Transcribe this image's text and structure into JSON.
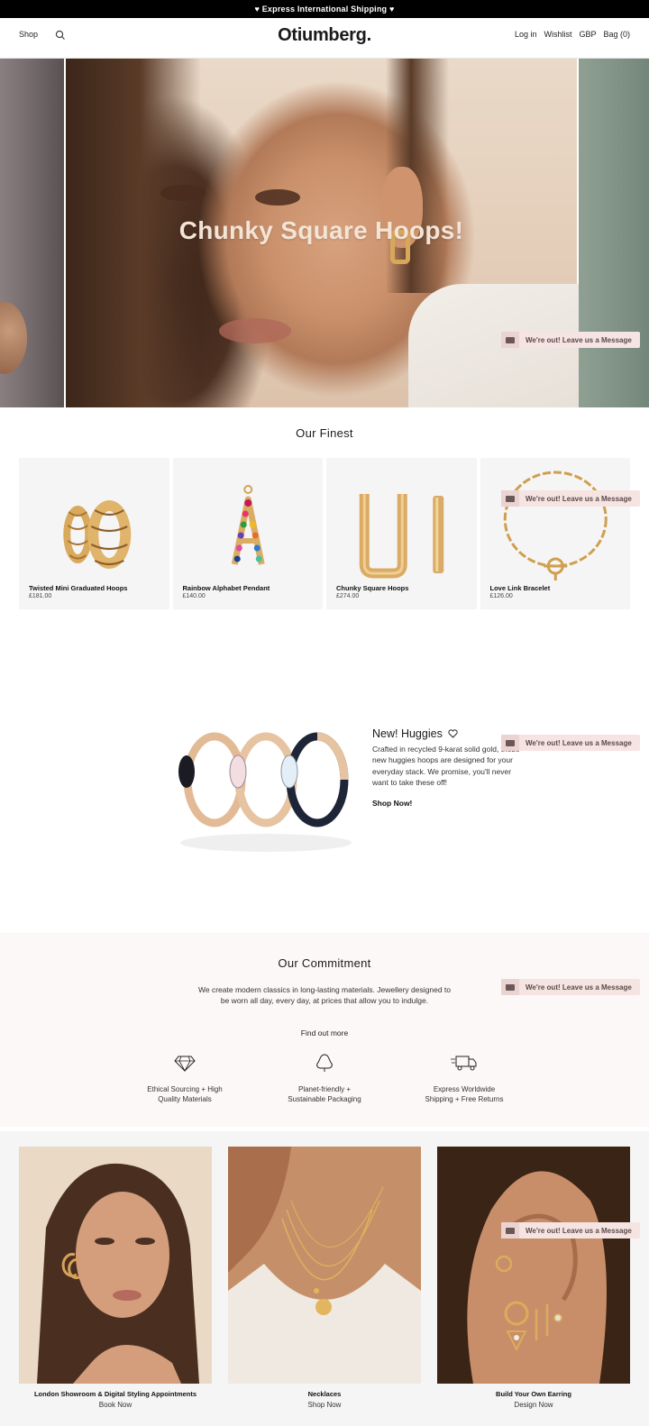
{
  "announcement": "♥ Express International Shipping ♥",
  "header": {
    "shop_label": "Shop",
    "logo": "Otiumberg.",
    "login_label": "Log in",
    "wishlist_label": "Wishlist",
    "currency_label": "GBP",
    "bag_label": "Bag (0)"
  },
  "hero": {
    "headline": "Chunky Square Hoops!"
  },
  "chat": {
    "label": "We're out! Leave us a Message"
  },
  "finest": {
    "title": "Our Finest",
    "products": [
      {
        "name": "Twisted Mini Graduated Hoops",
        "price": "£181.00"
      },
      {
        "name": "Rainbow Alphabet Pendant",
        "price": "£140.00"
      },
      {
        "name": "Chunky Square Hoops",
        "price": "£274.00"
      },
      {
        "name": "Love Link Bracelet",
        "price": "£126.00"
      }
    ]
  },
  "huggies": {
    "title": "New! Huggies",
    "body": "Crafted in recycled 9-karat solid gold, these new huggies hoops are designed for your everyday stack. We promise, you'll never want to take these off!",
    "cta": "Shop Now!"
  },
  "commitment": {
    "title": "Our Commitment",
    "body": "We create modern classics in long-lasting materials. Jewellery designed to be worn all day, every day, at prices that allow you to indulge.",
    "link": "Find out more",
    "features": [
      {
        "icon": "diamond-icon",
        "line1": "Ethical Sourcing + High",
        "line2": "Quality Materials"
      },
      {
        "icon": "plant-icon",
        "line1": "Planet-friendly +",
        "line2": "Sustainable Packaging"
      },
      {
        "icon": "truck-icon",
        "line1": "Express Worldwide",
        "line2": "Shipping + Free Returns"
      }
    ]
  },
  "tiles": [
    {
      "title": "London Showroom & Digital Styling Appointments",
      "link": "Book Now"
    },
    {
      "title": "Necklaces",
      "link": "Shop Now"
    },
    {
      "title": "Build Your Own Earring",
      "link": "Design Now"
    }
  ]
}
